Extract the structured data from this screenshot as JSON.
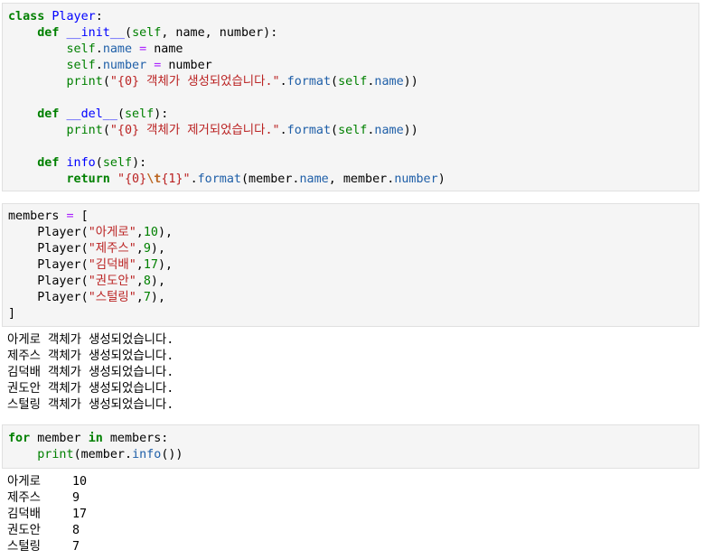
{
  "cells": {
    "cell1": {
      "lines": [
        [
          {
            "t": "class",
            "c": "kw"
          },
          {
            "t": " ",
            "c": "plain"
          },
          {
            "t": "Player",
            "c": "cls"
          },
          {
            "t": ":",
            "c": "plain"
          }
        ],
        [
          {
            "t": "    ",
            "c": "plain"
          },
          {
            "t": "def",
            "c": "kw"
          },
          {
            "t": " ",
            "c": "plain"
          },
          {
            "t": "__init__",
            "c": "fn"
          },
          {
            "t": "(",
            "c": "plain"
          },
          {
            "t": "self",
            "c": "self"
          },
          {
            "t": ", name, number):",
            "c": "plain"
          }
        ],
        [
          {
            "t": "        ",
            "c": "plain"
          },
          {
            "t": "self",
            "c": "self"
          },
          {
            "t": ".",
            "c": "plain"
          },
          {
            "t": "name",
            "c": "attr"
          },
          {
            "t": " ",
            "c": "plain"
          },
          {
            "t": "=",
            "c": "op"
          },
          {
            "t": " name",
            "c": "plain"
          }
        ],
        [
          {
            "t": "        ",
            "c": "plain"
          },
          {
            "t": "self",
            "c": "self"
          },
          {
            "t": ".",
            "c": "plain"
          },
          {
            "t": "number",
            "c": "attr"
          },
          {
            "t": " ",
            "c": "plain"
          },
          {
            "t": "=",
            "c": "op"
          },
          {
            "t": " number",
            "c": "plain"
          }
        ],
        [
          {
            "t": "        ",
            "c": "plain"
          },
          {
            "t": "print",
            "c": "bi"
          },
          {
            "t": "(",
            "c": "plain"
          },
          {
            "t": "\"{0} 객체가 생성되었습니다.\"",
            "c": "str"
          },
          {
            "t": ".",
            "c": "plain"
          },
          {
            "t": "format",
            "c": "attr"
          },
          {
            "t": "(",
            "c": "plain"
          },
          {
            "t": "self",
            "c": "self"
          },
          {
            "t": ".",
            "c": "plain"
          },
          {
            "t": "name",
            "c": "attr"
          },
          {
            "t": "))",
            "c": "plain"
          }
        ],
        [],
        [
          {
            "t": "    ",
            "c": "plain"
          },
          {
            "t": "def",
            "c": "kw"
          },
          {
            "t": " ",
            "c": "plain"
          },
          {
            "t": "__del__",
            "c": "fn"
          },
          {
            "t": "(",
            "c": "plain"
          },
          {
            "t": "self",
            "c": "self"
          },
          {
            "t": "):",
            "c": "plain"
          }
        ],
        [
          {
            "t": "        ",
            "c": "plain"
          },
          {
            "t": "print",
            "c": "bi"
          },
          {
            "t": "(",
            "c": "plain"
          },
          {
            "t": "\"{0} 객체가 제거되었습니다.\"",
            "c": "str"
          },
          {
            "t": ".",
            "c": "plain"
          },
          {
            "t": "format",
            "c": "attr"
          },
          {
            "t": "(",
            "c": "plain"
          },
          {
            "t": "self",
            "c": "self"
          },
          {
            "t": ".",
            "c": "plain"
          },
          {
            "t": "name",
            "c": "attr"
          },
          {
            "t": "))",
            "c": "plain"
          }
        ],
        [],
        [
          {
            "t": "    ",
            "c": "plain"
          },
          {
            "t": "def",
            "c": "kw"
          },
          {
            "t": " ",
            "c": "plain"
          },
          {
            "t": "info",
            "c": "fn"
          },
          {
            "t": "(",
            "c": "plain"
          },
          {
            "t": "self",
            "c": "self"
          },
          {
            "t": "):",
            "c": "plain"
          }
        ],
        [
          {
            "t": "        ",
            "c": "plain"
          },
          {
            "t": "return",
            "c": "kw"
          },
          {
            "t": " ",
            "c": "plain"
          },
          {
            "t": "\"",
            "c": "str"
          },
          {
            "t": "{0}",
            "c": "str"
          },
          {
            "t": "\\t",
            "c": "esc"
          },
          {
            "t": "{1}\"",
            "c": "str"
          },
          {
            "t": ".",
            "c": "plain"
          },
          {
            "t": "format",
            "c": "attr"
          },
          {
            "t": "(member.",
            "c": "plain"
          },
          {
            "t": "name",
            "c": "attr"
          },
          {
            "t": ", member.",
            "c": "plain"
          },
          {
            "t": "number",
            "c": "attr"
          },
          {
            "t": ")",
            "c": "plain"
          }
        ]
      ]
    },
    "cell2": {
      "lines": [
        [
          {
            "t": "members ",
            "c": "plain"
          },
          {
            "t": "=",
            "c": "op"
          },
          {
            "t": " [",
            "c": "plain"
          }
        ],
        [
          {
            "t": "    Player(",
            "c": "plain"
          },
          {
            "t": "\"아게로\"",
            "c": "str"
          },
          {
            "t": ",",
            "c": "plain"
          },
          {
            "t": "10",
            "c": "num"
          },
          {
            "t": "),",
            "c": "plain"
          }
        ],
        [
          {
            "t": "    Player(",
            "c": "plain"
          },
          {
            "t": "\"제주스\"",
            "c": "str"
          },
          {
            "t": ",",
            "c": "plain"
          },
          {
            "t": "9",
            "c": "num"
          },
          {
            "t": "),",
            "c": "plain"
          }
        ],
        [
          {
            "t": "    Player(",
            "c": "plain"
          },
          {
            "t": "\"김덕배\"",
            "c": "str"
          },
          {
            "t": ",",
            "c": "plain"
          },
          {
            "t": "17",
            "c": "num"
          },
          {
            "t": "),",
            "c": "plain"
          }
        ],
        [
          {
            "t": "    Player(",
            "c": "plain"
          },
          {
            "t": "\"권도안\"",
            "c": "str"
          },
          {
            "t": ",",
            "c": "plain"
          },
          {
            "t": "8",
            "c": "num"
          },
          {
            "t": "),",
            "c": "plain"
          }
        ],
        [
          {
            "t": "    Player(",
            "c": "plain"
          },
          {
            "t": "\"스털링\"",
            "c": "str"
          },
          {
            "t": ",",
            "c": "plain"
          },
          {
            "t": "7",
            "c": "num"
          },
          {
            "t": "),",
            "c": "plain"
          }
        ],
        [
          {
            "t": "]",
            "c": "plain"
          }
        ]
      ],
      "output": [
        "아게로 객체가 생성되었습니다.",
        "제주스 객체가 생성되었습니다.",
        "김덕배 객체가 생성되었습니다.",
        "권도안 객체가 생성되었습니다.",
        "스털링 객체가 생성되었습니다."
      ]
    },
    "cell3": {
      "lines": [
        [
          {
            "t": "for",
            "c": "kw"
          },
          {
            "t": " member ",
            "c": "plain"
          },
          {
            "t": "in",
            "c": "kw"
          },
          {
            "t": " members:",
            "c": "plain"
          }
        ],
        [
          {
            "t": "    ",
            "c": "plain"
          },
          {
            "t": "print",
            "c": "bi"
          },
          {
            "t": "(member.",
            "c": "plain"
          },
          {
            "t": "info",
            "c": "attr"
          },
          {
            "t": "())",
            "c": "plain"
          }
        ]
      ],
      "output": [
        {
          "name": "아게로",
          "number": "10"
        },
        {
          "name": "제주스",
          "number": "9"
        },
        {
          "name": "김덕배",
          "number": "17"
        },
        {
          "name": "권도안",
          "number": "8"
        },
        {
          "name": "스털링",
          "number": "7"
        }
      ]
    }
  }
}
